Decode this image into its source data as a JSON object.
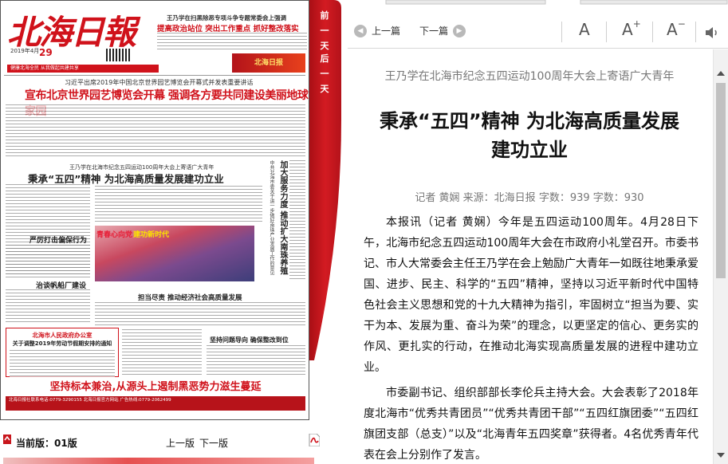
{
  "newspaper": {
    "masthead": "北海日報",
    "date_line": "2019年4月",
    "issue_day": "29",
    "headline_top": "王乃学在扫黑除恶专项斗争专题常委会上强调",
    "headline_sub": "提高政治站位  突出工作重点  抓好整改落实",
    "promo_text": "北海日报",
    "band_text": "健康北海全民  从我做起共建共享",
    "lead_kicker": "习近平出席2019年中国北京世界园艺博览会开幕式并发表重要讲话",
    "lead_title": "宣布北京世界园艺博览会开幕  强调各方要共同建设美丽地球家园",
    "second_kicker": "王乃学在北海市纪念五四运动100周年大会上寄语广大青年",
    "second_title": "秉承“五四”精神  为北海高质量发展建功立业",
    "vertical_head": "加大服务力度  推动扩大南珠养殖",
    "vertical_head2": "中共北海市委关于进一步做好南珠产业发展工作的意见",
    "photo_caption_red": "青春心向党",
    "photo_caption_yellow": "建功新时代",
    "sub_head_1": "严厉打击偏保行为",
    "sub_head_2": "治谈帆船厂建设",
    "sub_head_3": "担当尽责  推动经济社会高质量发展",
    "box_title_1": "北海市人民政府办公室",
    "box_title_2": "关于调整2019年劳动节假期安排的通知",
    "box_title_3": "坚持问题导向  确保整改到位",
    "bottom_banner": "坚持标本兼治,从源头上遏制黑恶势力滋生蔓延",
    "ads_text": "北海日报社联系电话:0779-3290155  北海日报官方网站  广告热线:0779-2062499"
  },
  "day_nav": {
    "prev_day": "前一天",
    "next_day": "后一天"
  },
  "paper_footer": {
    "current_edition": "当前版：01版",
    "prev_edition": "上一版",
    "next_edition": "下一版"
  },
  "toolbar": {
    "prev_article": "上一篇",
    "next_article": "下一篇",
    "font_normal": "A",
    "font_increase": "A",
    "font_increase_sign": "+",
    "font_decrease": "A",
    "font_decrease_sign": "−"
  },
  "article": {
    "kicker": "王乃学在北海市纪念五四运动100周年大会上寄语广大青年",
    "title_line1": "秉承“五四”精神  为北海高质量发展",
    "title_line2": "建功立业",
    "meta": "记者 黄娴 来源：北海日报 字数：939 字数：930",
    "paragraphs": [
      "本报讯（记者 黄娴）今年是五四运动100周年。4月28日下午，北海市纪念五四运动100周年大会在市政府小礼堂召开。市委书记、市人大常委会主任王乃学在会上勉励广大青年一如既往地秉承爱国、进步、民主、科学的“五四”精神，坚持以习近平新时代中国特色社会主义思想和党的十九大精神为指引，牢固树立“担当为要、实干为本、发展为重、奋斗为荣”的理念，以更坚定的信心、更务实的作风、更扎实的行动，在推动北海实现高质量发展的进程中建功立业。",
      "市委副书记、组织部部长李伦兵主持大会。大会表彰了2018年度北海市“优秀共青团员”“优秀共青团干部”“五四红旗团委”“五四红旗团支部（总支）”以及“北海青年五四奖章”获得者。4名优秀青年代表在会上分别作了发言。"
    ]
  },
  "colors": {
    "brand_red": "#d0121b",
    "tab_red": "#c8161d"
  },
  "icons": [
    "left-arrow-icon",
    "right-arrow-icon",
    "speaker-icon",
    "pdf-icon",
    "edition-icon"
  ]
}
